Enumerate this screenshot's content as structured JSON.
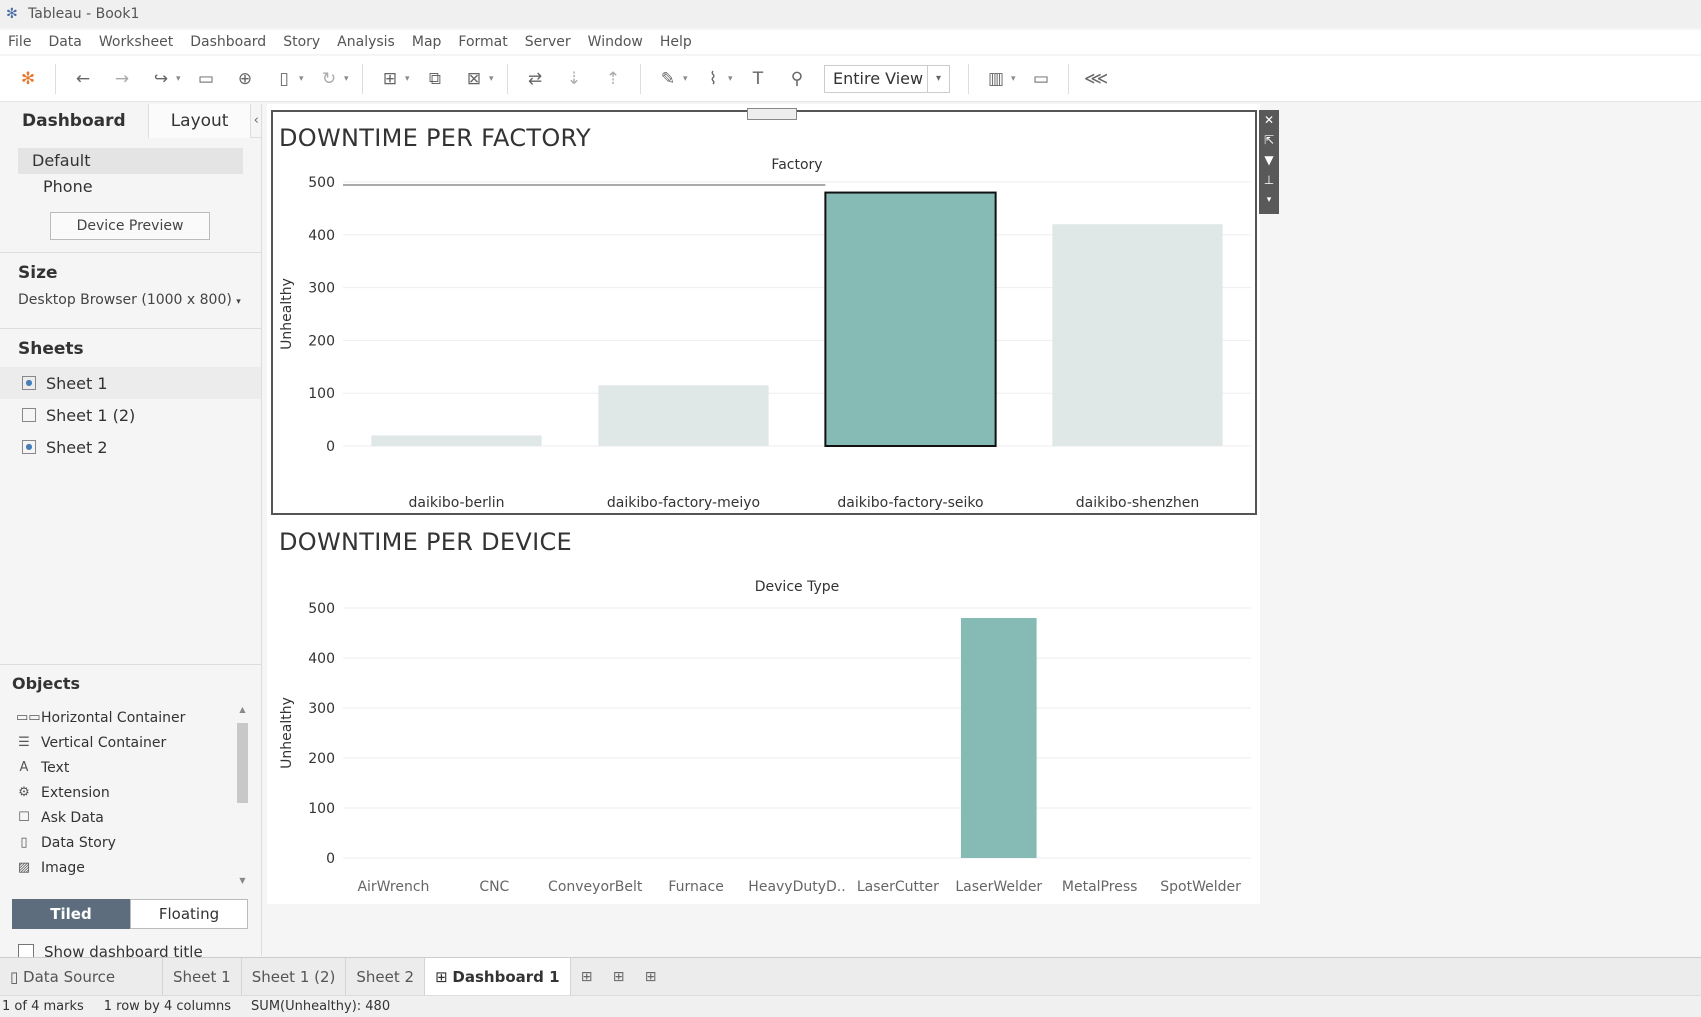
{
  "window": {
    "title": "Tableau - Book1"
  },
  "menu": [
    "File",
    "Data",
    "Worksheet",
    "Dashboard",
    "Story",
    "Analysis",
    "Map",
    "Format",
    "Server",
    "Window",
    "Help"
  ],
  "toolbar": {
    "fit_label": "Entire View"
  },
  "sidebar": {
    "tabs": {
      "dashboard": "Dashboard",
      "layout": "Layout"
    },
    "devices": {
      "default": "Default",
      "phone": "Phone",
      "preview_button": "Device Preview"
    },
    "size": {
      "heading": "Size",
      "value": "Desktop Browser (1000 x 800)"
    },
    "sheets": {
      "heading": "Sheets",
      "items": [
        "Sheet 1",
        "Sheet 1 (2)",
        "Sheet 2"
      ]
    },
    "objects": {
      "heading": "Objects",
      "items": [
        "Horizontal Container",
        "Vertical Container",
        "Text",
        "Extension",
        "Ask Data",
        "Data Story",
        "Image"
      ],
      "tiled": "Tiled",
      "floating": "Floating",
      "show_title": "Show dashboard title"
    }
  },
  "dashboard": {
    "factory_title": "DOWNTIME PER FACTORY",
    "device_title": "DOWNTIME PER DEVICE"
  },
  "chart_data": [
    {
      "type": "bar",
      "title": "DOWNTIME PER FACTORY",
      "xlabel": "Factory",
      "ylabel": "Unhealthy",
      "categories": [
        "daikibo-berlin",
        "daikibo-factory-meiyo",
        "daikibo-factory-seiko",
        "daikibo-shenzhen"
      ],
      "values": [
        20,
        115,
        480,
        420
      ],
      "ylim": [
        0,
        500
      ],
      "yticks": [
        0,
        100,
        200,
        300,
        400,
        500
      ],
      "highlight_index": 2,
      "colors": {
        "highlight": "#86bab5",
        "dimmed": "#dfe8e6"
      }
    },
    {
      "type": "bar",
      "title": "DOWNTIME PER DEVICE",
      "xlabel": "Device Type",
      "ylabel": "Unhealthy",
      "categories": [
        "AirWrench",
        "CNC",
        "ConveyorBelt",
        "Furnace",
        "HeavyDutyD..",
        "LaserCutter",
        "LaserWelder",
        "MetalPress",
        "SpotWelder"
      ],
      "values": [
        0,
        0,
        0,
        0,
        0,
        0,
        480,
        0,
        0
      ],
      "ylim": [
        0,
        500
      ],
      "yticks": [
        0,
        100,
        200,
        300,
        400,
        500
      ],
      "colors": {
        "bar": "#86bab5"
      }
    }
  ],
  "bottom_tabs": [
    "Data Source",
    "Sheet 1",
    "Sheet 1 (2)",
    "Sheet 2",
    "Dashboard 1"
  ],
  "status": {
    "marks": "1 of 4 marks",
    "rows": "1 row by 4 columns",
    "sum": "SUM(Unhealthy): 480"
  }
}
